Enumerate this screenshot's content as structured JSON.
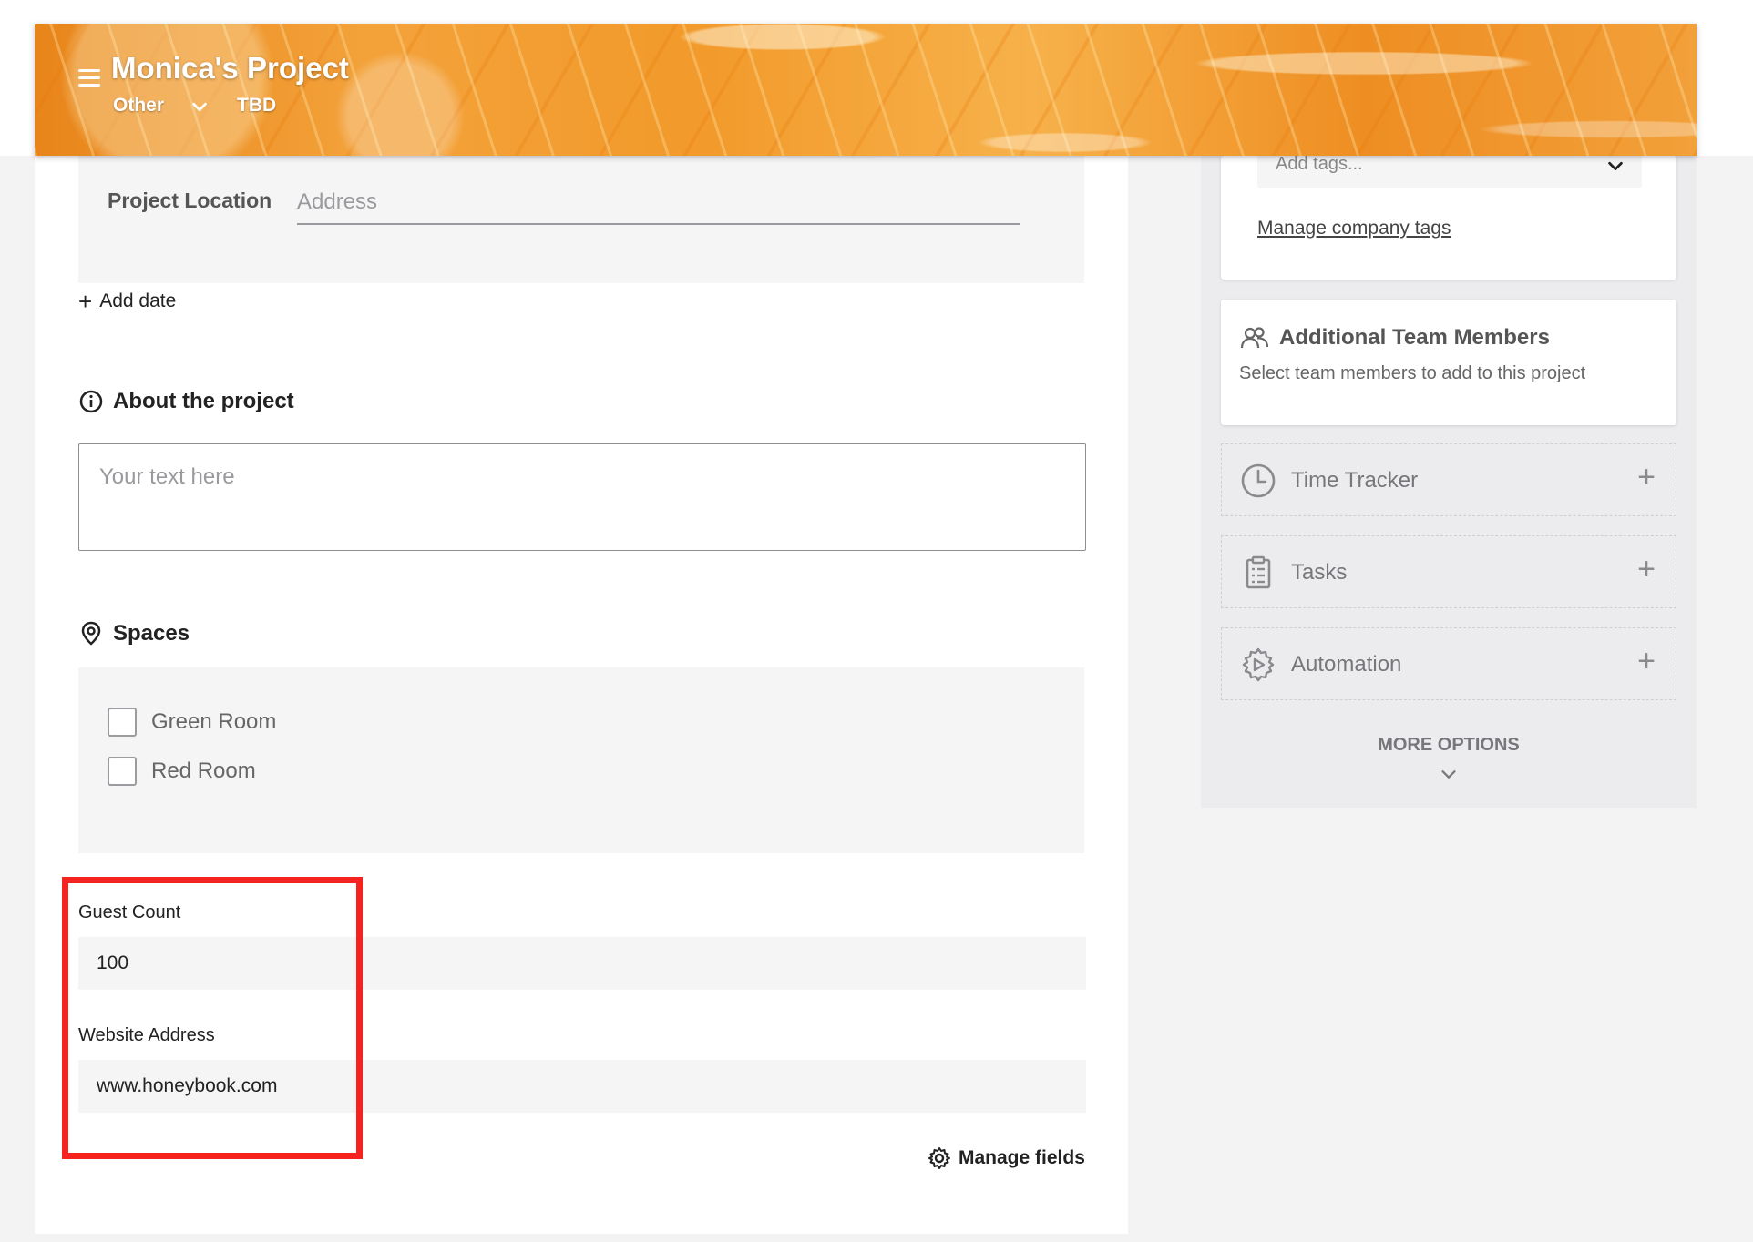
{
  "header": {
    "title": "Monica's Project",
    "type": "Other",
    "date": "TBD"
  },
  "details": {
    "location_label": "Project Location",
    "location_placeholder": "Address",
    "add_date_label": "Add date"
  },
  "about": {
    "heading": "About the project",
    "placeholder": "Your text here"
  },
  "spaces": {
    "heading": "Spaces",
    "items": [
      {
        "label": "Green Room",
        "checked": false
      },
      {
        "label": "Red Room",
        "checked": false
      }
    ]
  },
  "custom_fields": {
    "guest_count_label": "Guest Count",
    "guest_count_value": "100",
    "website_label": "Website Address",
    "website_value": "www.honeybook.com",
    "manage_fields_label": "Manage fields"
  },
  "sidebar": {
    "tags_placeholder": "Add tags...",
    "manage_tags_label": "Manage company tags",
    "team_title": "Additional Team Members",
    "team_subtitle": "Select team members to add to this project",
    "tools": [
      {
        "label": "Time Tracker",
        "icon": "clock-icon"
      },
      {
        "label": "Tasks",
        "icon": "clipboard-icon"
      },
      {
        "label": "Automation",
        "icon": "automation-gear-icon"
      }
    ],
    "more_options_label": "MORE OPTIONS"
  },
  "colors": {
    "highlight": "#f4231f",
    "banner": "#f29a2b"
  }
}
